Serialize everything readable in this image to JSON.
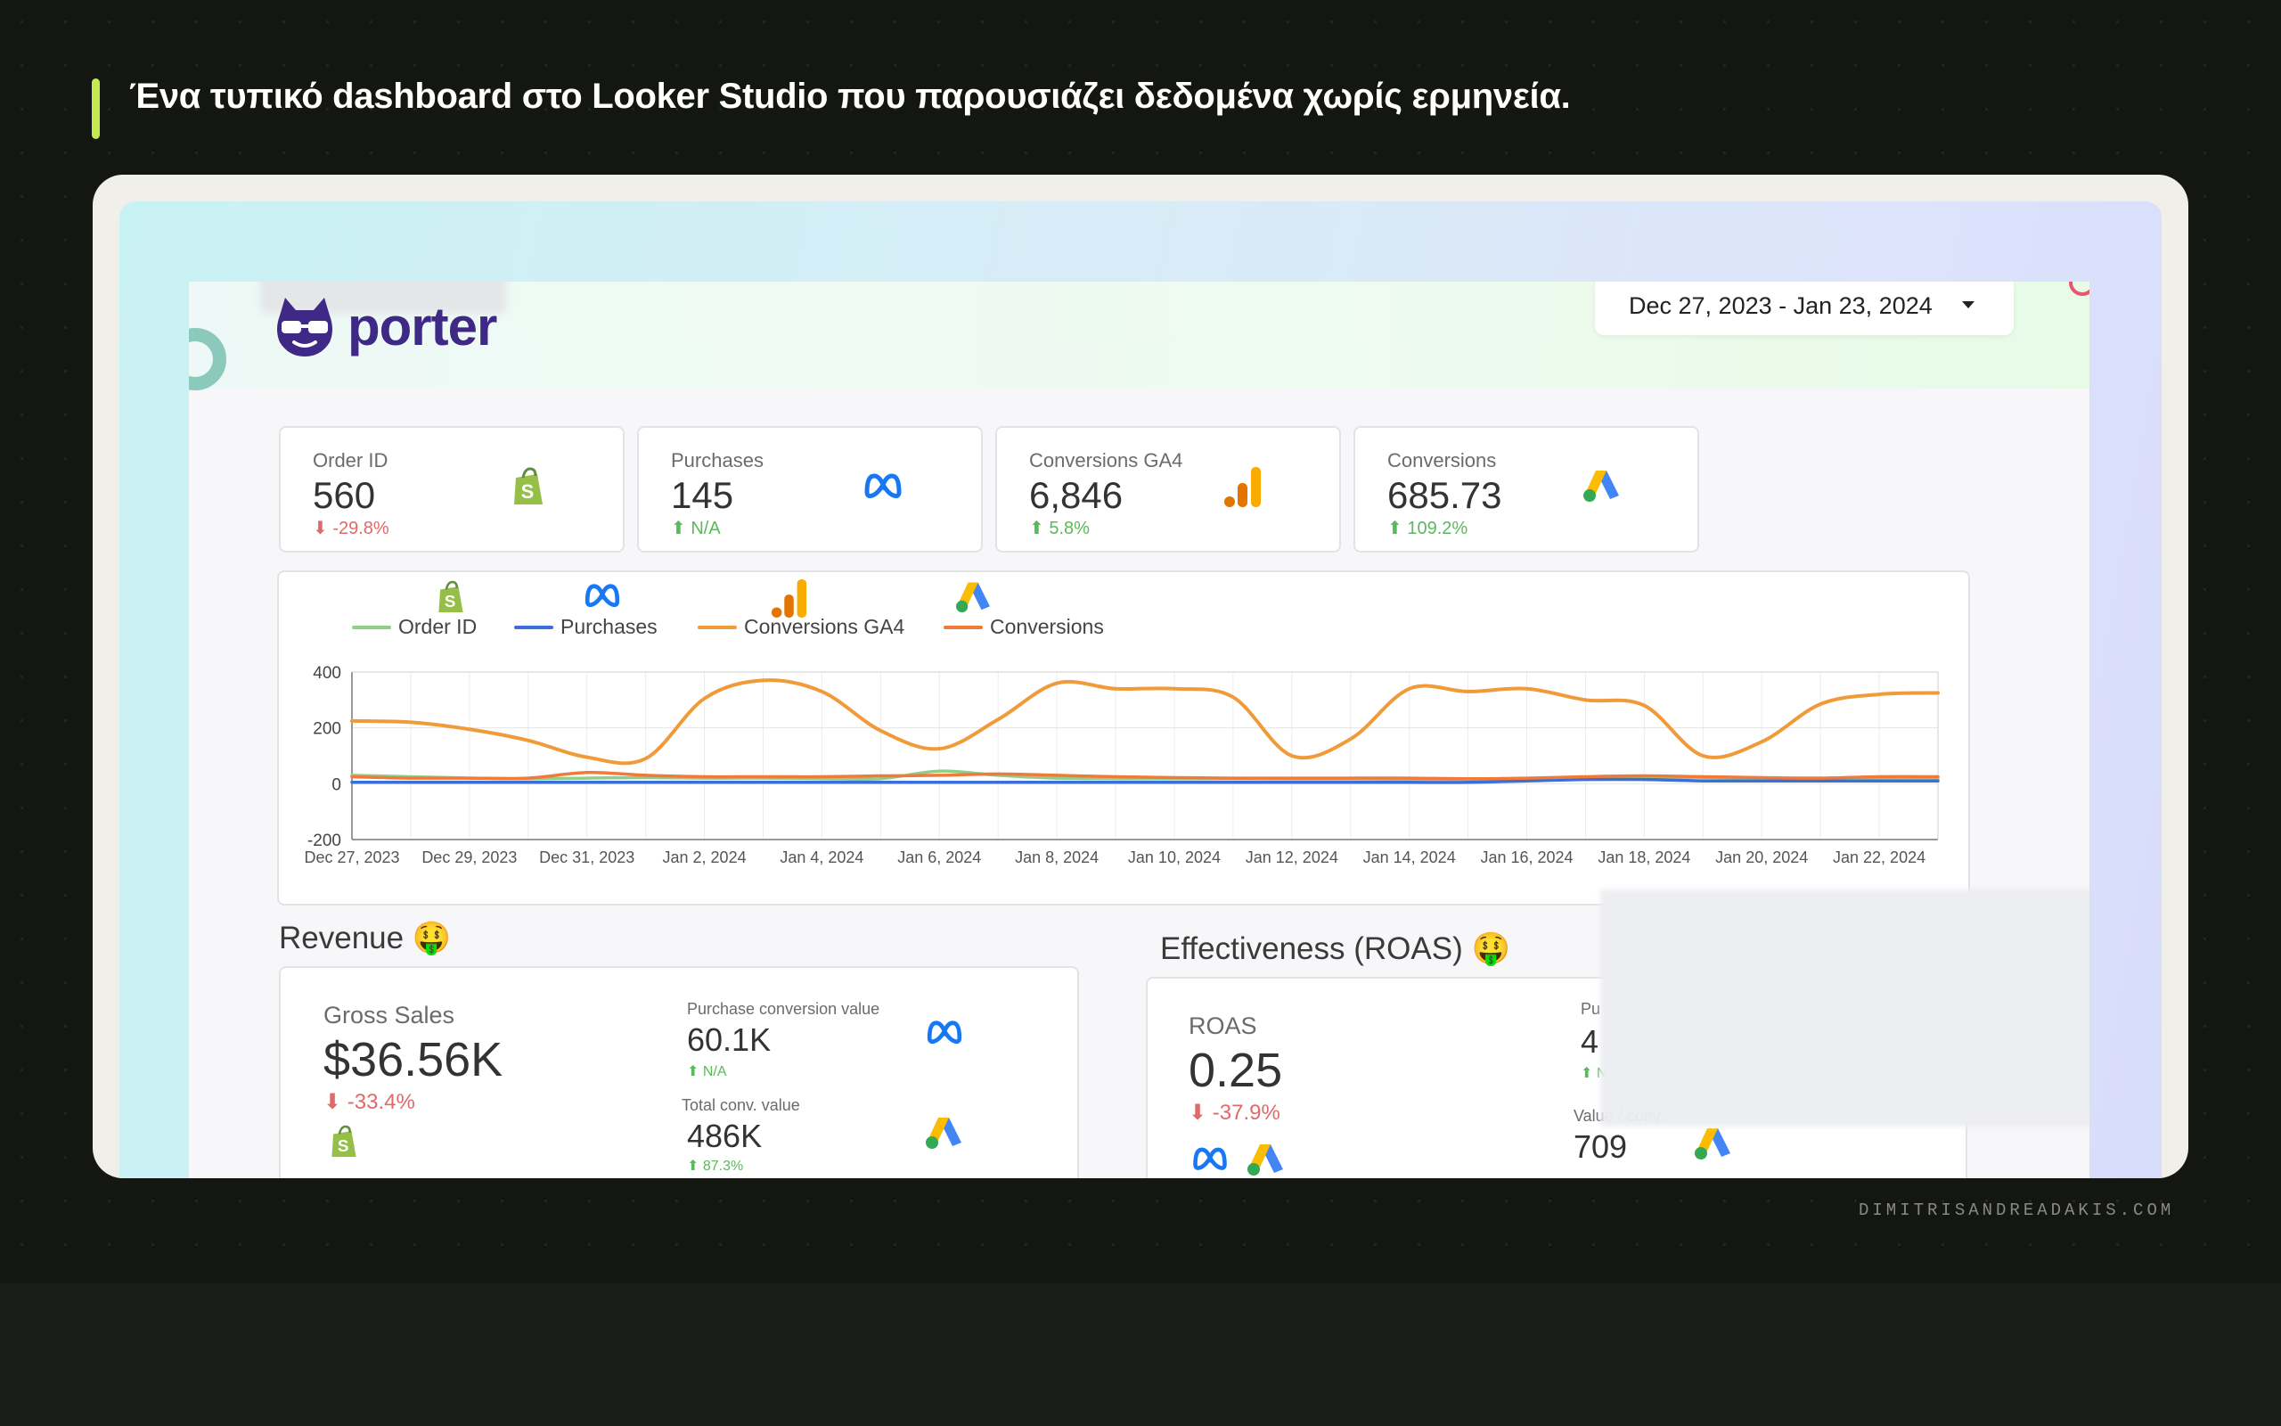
{
  "caption": "Ένα τυπικό dashboard στο Looker Studio που παρουσιάζει δεδομένα χωρίς ερμηνεία.",
  "watermark": "DIMITRISANDREADAKIS.COM",
  "brand": {
    "logo_text": "porter",
    "logo_color": "#3e2a86"
  },
  "date_range": {
    "label": "Dec 27, 2023 - Jan 23, 2024"
  },
  "kpis": [
    {
      "label": "Order ID",
      "value": "560",
      "delta": "-29.8%",
      "direction": "down",
      "icon": "shopify-icon"
    },
    {
      "label": "Purchases",
      "value": "145",
      "delta": "N/A",
      "direction": "up",
      "icon": "meta-icon"
    },
    {
      "label": "Conversions GA4",
      "value": "6,846",
      "delta": "5.8%",
      "direction": "up",
      "icon": "google-analytics-icon"
    },
    {
      "label": "Conversions",
      "value": "685.73",
      "delta": "109.2%",
      "direction": "up",
      "icon": "google-ads-icon"
    }
  ],
  "chart_data": {
    "type": "line",
    "x": [
      "Dec 27, 2023",
      "Dec 28, 2023",
      "Dec 29, 2023",
      "Dec 30, 2023",
      "Dec 31, 2023",
      "Jan 1, 2024",
      "Jan 2, 2024",
      "Jan 3, 2024",
      "Jan 4, 2024",
      "Jan 5, 2024",
      "Jan 6, 2024",
      "Jan 7, 2024",
      "Jan 8, 2024",
      "Jan 9, 2024",
      "Jan 10, 2024",
      "Jan 11, 2024",
      "Jan 12, 2024",
      "Jan 13, 2024",
      "Jan 14, 2024",
      "Jan 15, 2024",
      "Jan 16, 2024",
      "Jan 17, 2024",
      "Jan 18, 2024",
      "Jan 19, 2024",
      "Jan 20, 2024",
      "Jan 21, 2024",
      "Jan 22, 2024",
      "Jan 23, 2024"
    ],
    "tick_labels": [
      "Dec 27, 2023",
      "Dec 29, 2023",
      "Dec 31, 2023",
      "Jan 2, 2024",
      "Jan 4, 2024",
      "Jan 6, 2024",
      "Jan 8, 2024",
      "Jan 10, 2024",
      "Jan 12, 2024",
      "Jan 14, 2024",
      "Jan 16, 2024",
      "Jan 18, 2024",
      "Jan 20, 2024",
      "Jan 22, 2024"
    ],
    "y_ticks": [
      400,
      200,
      0,
      -200
    ],
    "ylim": [
      -200,
      400
    ],
    "grid": true,
    "legend_position": "top-left",
    "series": [
      {
        "name": "Order ID",
        "color": "#8fcf8a",
        "icon": "shopify-icon",
        "values": [
          30,
          25,
          20,
          18,
          20,
          22,
          20,
          20,
          18,
          18,
          45,
          30,
          20,
          18,
          18,
          18,
          17,
          17,
          16,
          16,
          18,
          20,
          22,
          22,
          20,
          20,
          18,
          18
        ]
      },
      {
        "name": "Purchases",
        "color": "#3b6fd8",
        "icon": "meta-icon",
        "values": [
          5,
          5,
          5,
          5,
          5,
          5,
          5,
          5,
          5,
          5,
          5,
          5,
          5,
          5,
          5,
          5,
          5,
          5,
          5,
          5,
          10,
          15,
          15,
          10,
          10,
          10,
          10,
          10
        ]
      },
      {
        "name": "Conversions GA4",
        "color": "#f09a3a",
        "icon": "google-analytics-icon",
        "values": [
          225,
          220,
          195,
          155,
          95,
          90,
          305,
          370,
          330,
          190,
          125,
          230,
          360,
          340,
          340,
          310,
          100,
          160,
          340,
          330,
          340,
          300,
          280,
          100,
          150,
          285,
          320,
          325
        ]
      },
      {
        "name": "Conversions",
        "color": "#f07a3a",
        "icon": "google-ads-icon",
        "values": [
          25,
          20,
          20,
          20,
          40,
          30,
          25,
          25,
          25,
          28,
          30,
          35,
          30,
          25,
          22,
          20,
          20,
          20,
          20,
          18,
          20,
          25,
          28,
          25,
          22,
          20,
          25,
          25
        ]
      }
    ]
  },
  "revenue": {
    "title": "Revenue 🤑",
    "gross_label": "Gross Sales",
    "gross_value": "$36.56K",
    "gross_delta": "-33.4%",
    "pcv_label": "Purchase conversion value",
    "pcv_value": "60.1K",
    "pcv_delta": "N/A",
    "tcv_label": "Total conv. value",
    "tcv_value": "486K",
    "tcv_delta": "87.3%"
  },
  "roas": {
    "title": "Effectiveness (ROAS) 🤑",
    "label": "ROAS",
    "value": "0.25",
    "delta": "-37.9%",
    "partial_label": "Pu",
    "partial_value": "4",
    "partial_delta": "N",
    "vpc_label": "Value / conv.",
    "vpc_value": "709"
  }
}
